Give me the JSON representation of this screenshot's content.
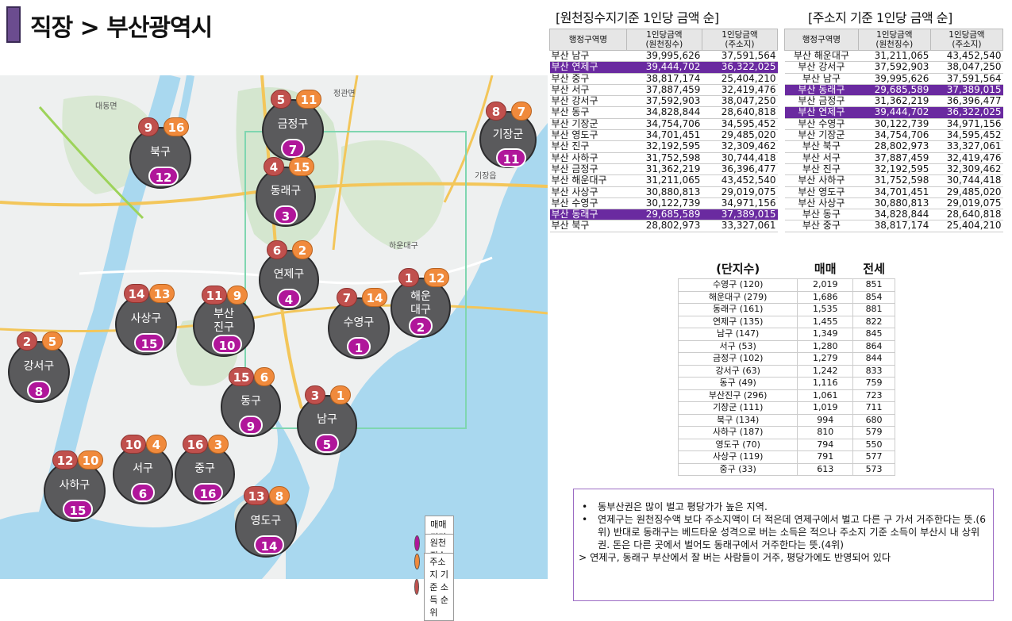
{
  "header": {
    "title": "직장 > 부산광역시"
  },
  "map": {
    "labels": [
      "대동면",
      "기장읍",
      "하운대구",
      "정관면"
    ],
    "districts": [
      {
        "name": "금정구",
        "res": "5",
        "src": "11",
        "sale": "7"
      },
      {
        "name": "기장군",
        "res": "8",
        "src": "7",
        "sale": "11"
      },
      {
        "name": "북구",
        "res": "9",
        "src": "16",
        "sale": "12"
      },
      {
        "name": "동래구",
        "res": "4",
        "src": "15",
        "sale": "3"
      },
      {
        "name": "연제구",
        "res": "6",
        "src": "2",
        "sale": "4"
      },
      {
        "name": "사상구",
        "res": "14",
        "src": "13",
        "sale": "15"
      },
      {
        "name": "부산 진구",
        "res": "11",
        "src": "9",
        "sale": "10"
      },
      {
        "name": "수영구",
        "res": "7",
        "src": "14",
        "sale": "1"
      },
      {
        "name": "해운 대구",
        "res": "1",
        "src": "12",
        "sale": "2"
      },
      {
        "name": "강서구",
        "res": "2",
        "src": "5",
        "sale": "8"
      },
      {
        "name": "동구",
        "res": "15",
        "src": "6",
        "sale": "9"
      },
      {
        "name": "남구",
        "res": "3",
        "src": "1",
        "sale": "5"
      },
      {
        "name": "서구",
        "res": "10",
        "src": "4",
        "sale": "6"
      },
      {
        "name": "중구",
        "res": "16",
        "src": "3",
        "sale": "16"
      },
      {
        "name": "사하구",
        "res": "12",
        "src": "10",
        "sale": "15"
      },
      {
        "name": "영도구",
        "res": "13",
        "src": "8",
        "sale": "14"
      }
    ],
    "legend": [
      {
        "label": "매매 평당가 순위",
        "color": "#b0169a"
      },
      {
        "label": "원천징수 소득 순위",
        "color": "#f08a3c"
      },
      {
        "label": "주소지 기준 소득 순위",
        "color": "#c0504d"
      }
    ]
  },
  "table1": {
    "title": "[원천징수지기준 1인당 금액 순]",
    "headers": [
      "행정구역명",
      "1인당금액\n(원천징수)",
      "1인당금액\n(주소지)"
    ],
    "rows": [
      [
        "부산 남구",
        "39,995,626",
        "37,591,564",
        false
      ],
      [
        "부산 연제구",
        "39,444,702",
        "36,322,025",
        true
      ],
      [
        "부산 중구",
        "38,817,174",
        "25,404,210",
        false
      ],
      [
        "부산 서구",
        "37,887,459",
        "32,419,476",
        false
      ],
      [
        "부산 강서구",
        "37,592,903",
        "38,047,250",
        false
      ],
      [
        "부산 동구",
        "34,828,844",
        "28,640,818",
        false
      ],
      [
        "부산 기장군",
        "34,754,706",
        "34,595,452",
        false
      ],
      [
        "부산 영도구",
        "34,701,451",
        "29,485,020",
        false
      ],
      [
        "부산 진구",
        "32,192,595",
        "32,309,462",
        false
      ],
      [
        "부산 사하구",
        "31,752,598",
        "30,744,418",
        false
      ],
      [
        "부산 금정구",
        "31,362,219",
        "36,396,477",
        false
      ],
      [
        "부산 해운대구",
        "31,211,065",
        "43,452,540",
        false
      ],
      [
        "부산 사상구",
        "30,880,813",
        "29,019,075",
        false
      ],
      [
        "부산 수영구",
        "30,122,739",
        "34,971,156",
        false
      ],
      [
        "부산 동래구",
        "29,685,589",
        "37,389,015",
        true
      ],
      [
        "부산 북구",
        "28,802,973",
        "33,327,061",
        false
      ]
    ]
  },
  "table2": {
    "title": "[주소지 기준 1인당 금액 순]",
    "headers": [
      "행정구역명",
      "1인당금액\n(원천징수)",
      "1인당금액\n(주소지)"
    ],
    "rows": [
      [
        "부산 해운대구",
        "31,211,065",
        "43,452,540",
        false
      ],
      [
        "부산 강서구",
        "37,592,903",
        "38,047,250",
        false
      ],
      [
        "부산 남구",
        "39,995,626",
        "37,591,564",
        false
      ],
      [
        "부산 동래구",
        "29,685,589",
        "37,389,015",
        true
      ],
      [
        "부산 금정구",
        "31,362,219",
        "36,396,477",
        false
      ],
      [
        "부산 연제구",
        "39,444,702",
        "36,322,025",
        true
      ],
      [
        "부산 수영구",
        "30,122,739",
        "34,971,156",
        false
      ],
      [
        "부산 기장군",
        "34,754,706",
        "34,595,452",
        false
      ],
      [
        "부산 북구",
        "28,802,973",
        "33,327,061",
        false
      ],
      [
        "부산 서구",
        "37,887,459",
        "32,419,476",
        false
      ],
      [
        "부산 진구",
        "32,192,595",
        "32,309,462",
        false
      ],
      [
        "부산 사하구",
        "31,752,598",
        "30,744,418",
        false
      ],
      [
        "부산 영도구",
        "34,701,451",
        "29,485,020",
        false
      ],
      [
        "부산 사상구",
        "30,880,813",
        "29,019,075",
        false
      ],
      [
        "부산 동구",
        "34,828,844",
        "28,640,818",
        false
      ],
      [
        "부산 중구",
        "38,817,174",
        "25,404,210",
        false
      ]
    ]
  },
  "table3": {
    "headers": [
      "(단지수)",
      "매매",
      "전세"
    ],
    "rows": [
      [
        "수영구 (120)",
        "2,019",
        "851"
      ],
      [
        "해운대구 (279)",
        "1,686",
        "854"
      ],
      [
        "동래구 (161)",
        "1,535",
        "881"
      ],
      [
        "연제구 (135)",
        "1,455",
        "822"
      ],
      [
        "남구 (147)",
        "1,349",
        "845"
      ],
      [
        "서구 (53)",
        "1,280",
        "864"
      ],
      [
        "금정구 (102)",
        "1,279",
        "844"
      ],
      [
        "강서구 (63)",
        "1,242",
        "833"
      ],
      [
        "동구 (49)",
        "1,116",
        "759"
      ],
      [
        "부산진구 (296)",
        "1,061",
        "723"
      ],
      [
        "기장군 (111)",
        "1,019",
        "711"
      ],
      [
        "북구 (134)",
        "994",
        "680"
      ],
      [
        "사하구 (187)",
        "810",
        "579"
      ],
      [
        "영도구 (70)",
        "794",
        "550"
      ],
      [
        "사상구 (119)",
        "791",
        "577"
      ],
      [
        "중구 (33)",
        "613",
        "573"
      ]
    ]
  },
  "notes": {
    "bullets": [
      "동부산권은 많이 벌고 평당가가 높은 지역.",
      "연제구는 원천징수액 보다 주소지액이 더 적은데 연제구에서 벌고 다른 구 가서 거주한다는 뜻.(6위) 반대로 동래구는 베드타운 성격으로 버는 소득은 적으나 주소지 기준 소득이 부산시 내 상위권. 돈은 다른 곳에서 벌어도 동래구에서 거주한다는 뜻.(4위)"
    ],
    "conclusion": "> 연제구, 동래구 부산에서 잘 버는 사람들이 거주, 평당가에도 반영되어 있다"
  }
}
